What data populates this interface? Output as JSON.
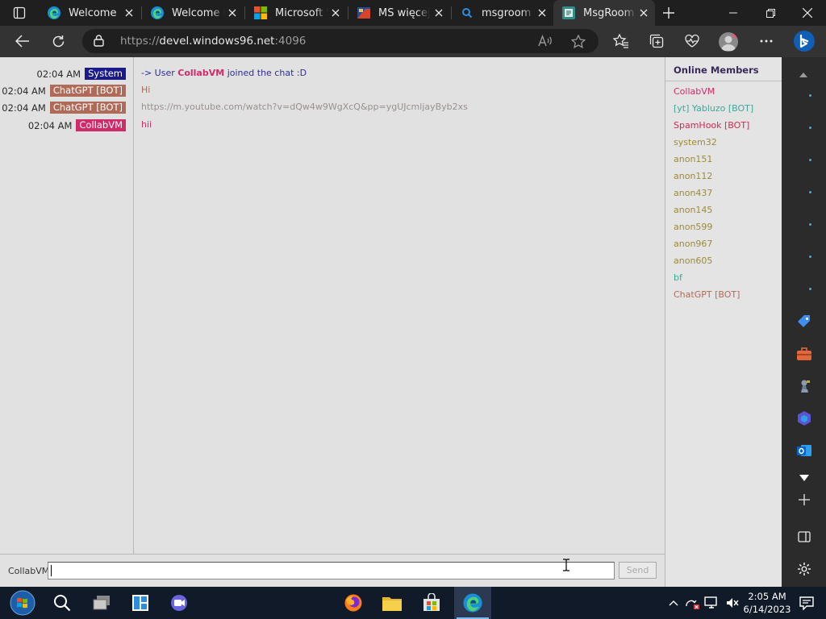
{
  "browser": {
    "tabs": [
      {
        "title": "Welcome",
        "icon": "edge-icon"
      },
      {
        "title": "Welcome to",
        "icon": "edge-icon"
      },
      {
        "title": "Microsoft St",
        "icon": "microsoft-icon"
      },
      {
        "title": "MS więcej n",
        "icon": "ms-flag-icon"
      },
      {
        "title": "msgroom -",
        "icon": "search-icon"
      },
      {
        "title": "MsgRoom -",
        "icon": "msgroom-icon",
        "active": true
      }
    ],
    "address": {
      "scheme": "https://",
      "host": "devel.windows96.net",
      "port": ":4096"
    }
  },
  "chat": {
    "messages": [
      {
        "time": "02:04 AM",
        "author": "System",
        "author_color": "#1a1a8c",
        "text_prefix": "-> User ",
        "text_highlight": "CollabVM",
        "text": " joined the chat :D"
      },
      {
        "time": "02:04 AM",
        "author": "ChatGPT [BOT]",
        "author_color": "#b06a58",
        "text": "Hi"
      },
      {
        "time": "02:04 AM",
        "author": "ChatGPT [BOT]",
        "author_color": "#b06a58",
        "text": "https://m.youtube.com/watch?v=dQw4w9WgXcQ&pp=ygUJcmljayByb2xs"
      },
      {
        "time": "02:04 AM",
        "author": "CollabVM",
        "author_color": "#d12a6a",
        "text": "hii"
      }
    ],
    "input": {
      "nickname": "CollabVM",
      "value": "",
      "send_label": "Send"
    }
  },
  "members": {
    "title": "Online Members",
    "list": [
      {
        "name": "CollabVM",
        "color": "#d12a6a"
      },
      {
        "name": "[yt] Yabluzo [BOT]",
        "color": "#3aa99a"
      },
      {
        "name": "SpamHook [BOT]",
        "color": "#d12a50"
      },
      {
        "name": "system32",
        "color": "#9a8c3a"
      },
      {
        "name": "anon151",
        "color": "#9a8c3a"
      },
      {
        "name": "anon112",
        "color": "#9a8c3a"
      },
      {
        "name": "anon437",
        "color": "#9a8c3a"
      },
      {
        "name": "anon145",
        "color": "#9a8c3a"
      },
      {
        "name": "anon599",
        "color": "#9a8c3a"
      },
      {
        "name": "anon967",
        "color": "#9a8c3a"
      },
      {
        "name": "anon605",
        "color": "#9a8c3a"
      },
      {
        "name": "bf",
        "color": "#3aa99a"
      },
      {
        "name": "ChatGPT [BOT]",
        "color": "#b06a58"
      }
    ]
  },
  "taskbar": {
    "time": "2:05 AM",
    "date": "6/14/2023"
  }
}
